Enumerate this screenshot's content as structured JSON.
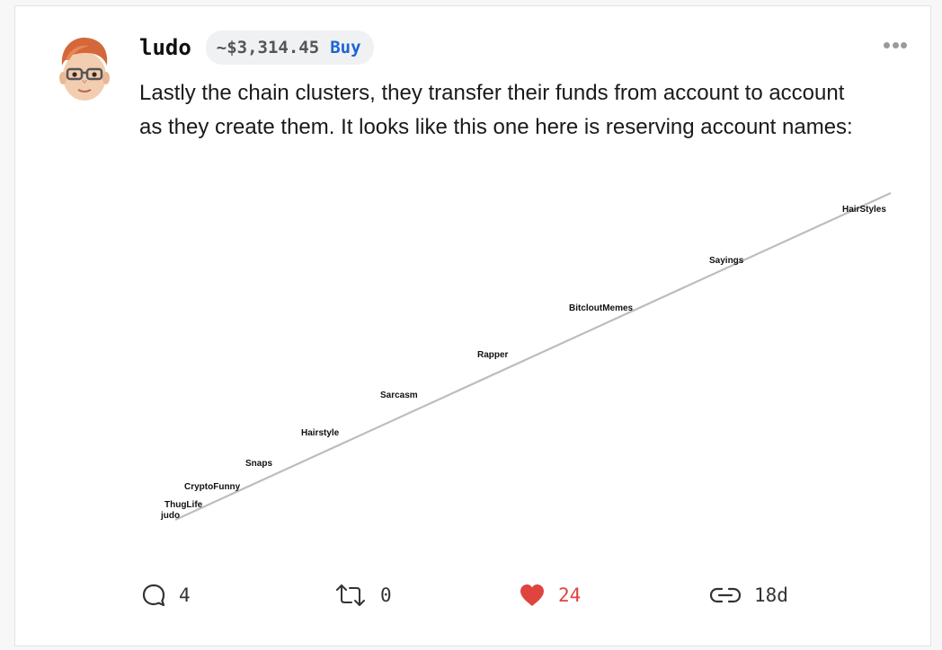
{
  "post": {
    "username": "ludo",
    "coin_price": "~$3,314.45",
    "buy_label": "Buy",
    "body": "Lastly the chain clusters, they transfer their funds from account to account as they create them. It looks like this one here is reserving account names:",
    "colors": {
      "like": "#e0443e",
      "buy": "#1d63d6"
    }
  },
  "chart_data": {
    "type": "line",
    "labels": [
      {
        "name": "judo",
        "idx": 0
      },
      {
        "name": "ThugLife",
        "idx": 1
      },
      {
        "name": "CryptoFunny",
        "idx": 2
      },
      {
        "name": "Snaps",
        "idx": 3
      },
      {
        "name": "Hairstyle",
        "idx": 4
      },
      {
        "name": "Sarcasm",
        "idx": 5
      },
      {
        "name": "Rapper",
        "idx": 6
      },
      {
        "name": "BitcloutMemes",
        "idx": 7
      },
      {
        "name": "Sayings",
        "idx": 8
      },
      {
        "name": "HairStyles",
        "idx": 9
      }
    ],
    "line_color": "#bdbdbd"
  },
  "actions": {
    "comments": "4",
    "reclouts": "0",
    "likes": "24",
    "age": "18d"
  }
}
